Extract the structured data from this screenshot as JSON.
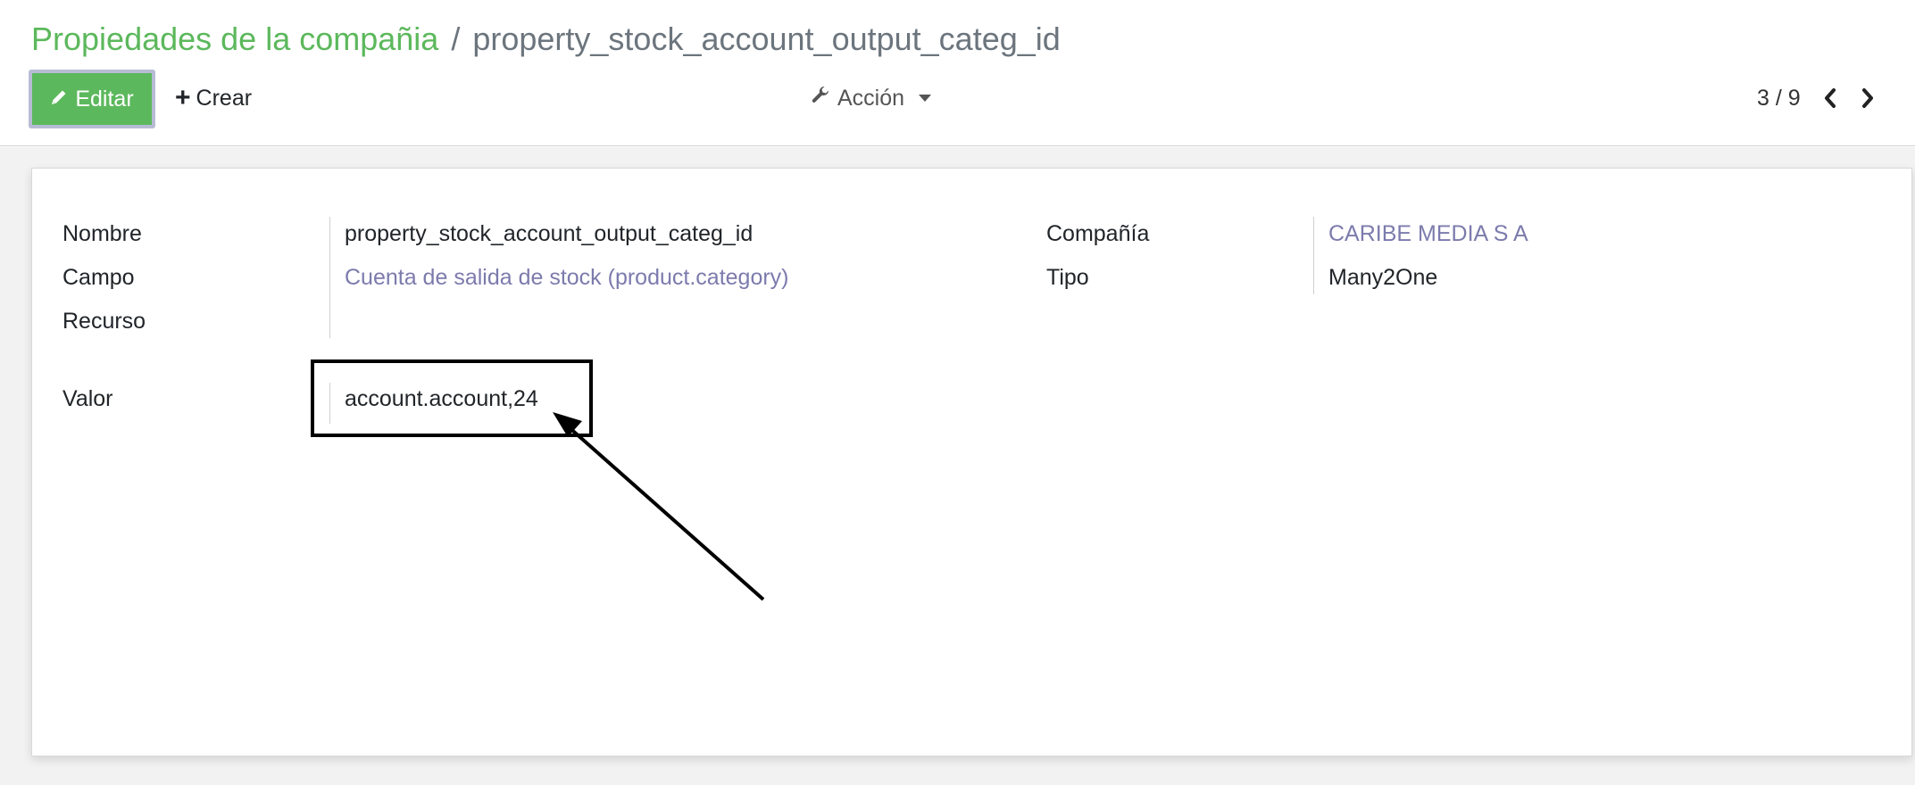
{
  "breadcrumb": {
    "parent": "Propiedades de la compañia",
    "separator": "/",
    "current": "property_stock_account_output_categ_id"
  },
  "toolbar": {
    "edit_label": "Editar",
    "create_label": "Crear",
    "action_label": "Acción"
  },
  "pager": {
    "value": "3 / 9"
  },
  "form": {
    "left": [
      {
        "label": "Nombre",
        "value": "property_stock_account_output_categ_id",
        "is_link": false
      },
      {
        "label": "Campo",
        "value": "Cuenta de salida de stock (product.category)",
        "is_link": true
      },
      {
        "label": "Recurso",
        "value": "",
        "is_link": false
      }
    ],
    "right": [
      {
        "label": "Compañía",
        "value": "CARIBE MEDIA S A",
        "is_link": true
      },
      {
        "label": "Tipo",
        "value": "Many2One",
        "is_link": false
      }
    ],
    "valor": {
      "label": "Valor",
      "value": "account.account,24"
    }
  },
  "colors": {
    "accent": "#5cb85c",
    "link": "#7c7bad"
  },
  "icons": [
    "pencil-icon",
    "plus-icon",
    "wrench-icon",
    "chevron-left-icon",
    "chevron-right-icon"
  ]
}
